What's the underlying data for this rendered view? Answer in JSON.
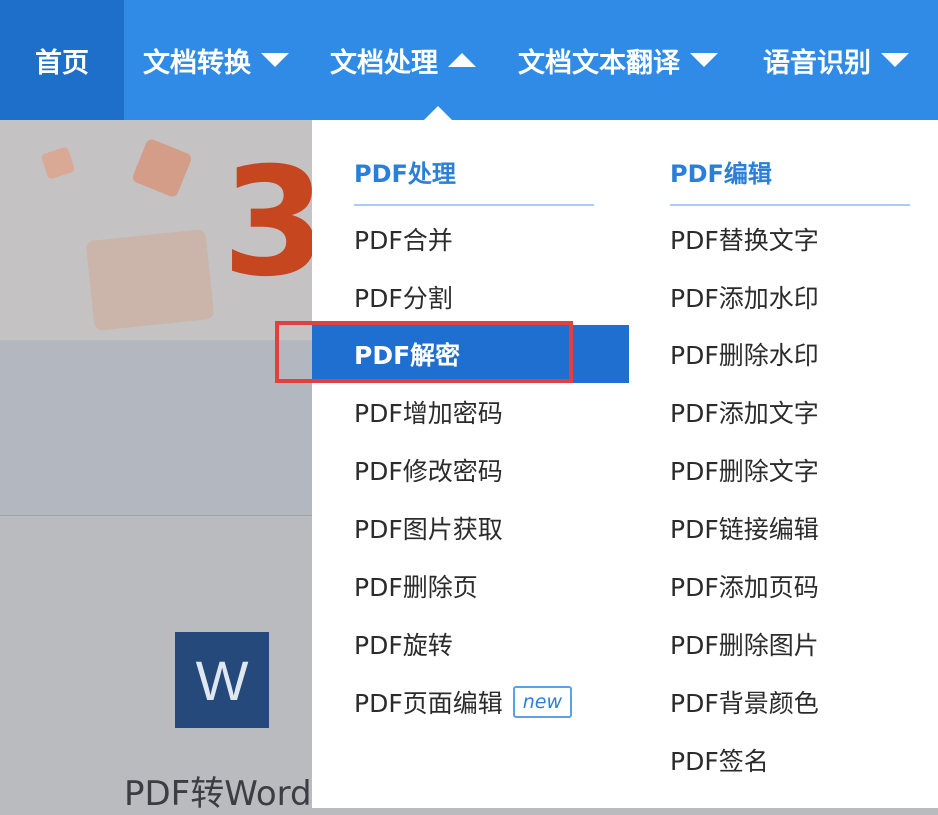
{
  "nav": {
    "home": "首页",
    "items": [
      {
        "label": "文档转换",
        "state": "collapsed"
      },
      {
        "label": "文档处理",
        "state": "expanded"
      },
      {
        "label": "文档文本翻译",
        "state": "collapsed"
      },
      {
        "label": "语音识别",
        "state": "collapsed"
      }
    ]
  },
  "background": {
    "banner_number": "3",
    "word_icon_letter": "W",
    "word_card_label": "PDF转Word"
  },
  "dropdown": {
    "left_column": {
      "heading": "PDF处理",
      "items": [
        "PDF合并",
        "PDF分割",
        "PDF解密",
        "PDF增加密码",
        "PDF修改密码",
        "PDF图片获取",
        "PDF删除页",
        "PDF旋转",
        "PDF页面编辑"
      ],
      "selected": "PDF解密",
      "badge": "new"
    },
    "right_column": {
      "heading": "PDF编辑",
      "items": [
        "PDF替换文字",
        "PDF添加水印",
        "PDF删除水印",
        "PDF添加文字",
        "PDF删除文字",
        "PDF链接编辑",
        "PDF添加页码",
        "PDF删除图片",
        "PDF背景颜色",
        "PDF签名"
      ]
    }
  },
  "colors": {
    "nav_bg": "#2f8be6",
    "nav_active": "#1e6fca",
    "menu_heading": "#2a7fd9",
    "selected_bg": "#1f6fd1",
    "annotation_box": "#e04040"
  }
}
